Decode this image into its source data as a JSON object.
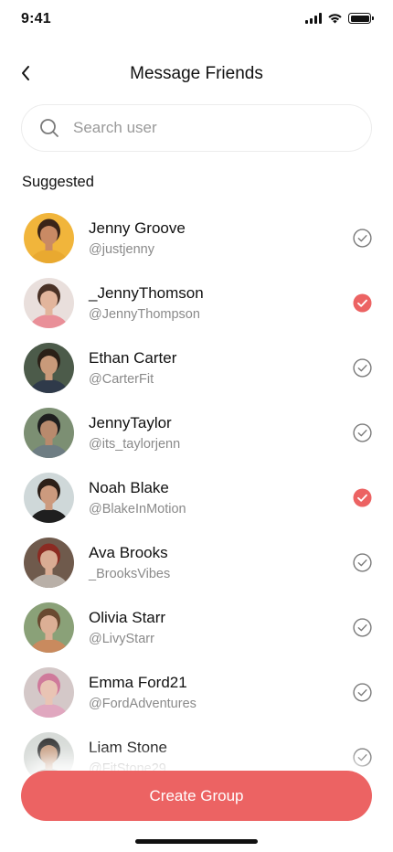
{
  "status_bar": {
    "time": "9:41"
  },
  "header": {
    "title": "Message Friends"
  },
  "search": {
    "placeholder": "Search user",
    "value": ""
  },
  "section": {
    "label": "Suggested"
  },
  "colors": {
    "accent": "#ec6363",
    "check_idle": "#7a7a7a",
    "muted_text": "#8a8a8a"
  },
  "users": [
    {
      "name": "Jenny Groove",
      "handle": "@justjenny",
      "selected": false,
      "avatar": {
        "bg": "#f1b53b",
        "skin": "#c98a64",
        "hair": "#3a2418",
        "shirt": "#e9a930"
      }
    },
    {
      "name": "_JennyThomson",
      "handle": "@JennyThompson",
      "selected": true,
      "avatar": {
        "bg": "#e9dfdc",
        "skin": "#e2b59c",
        "hair": "#4a3226",
        "shirt": "#e98f98"
      }
    },
    {
      "name": "Ethan Carter",
      "handle": "@CarterFit",
      "selected": false,
      "avatar": {
        "bg": "#4c5b4a",
        "skin": "#c99a7a",
        "hair": "#2b2017",
        "shirt": "#2f3a4a"
      }
    },
    {
      "name": "JennyTaylor",
      "handle": "@its_taylorjenn",
      "selected": false,
      "avatar": {
        "bg": "#7c8f73",
        "skin": "#b88a6d",
        "hair": "#1f1f1f",
        "shirt": "#6e7d83"
      }
    },
    {
      "name": "Noah Blake",
      "handle": "@BlakeInMotion",
      "selected": true,
      "avatar": {
        "bg": "#cfd8d9",
        "skin": "#cc9a7e",
        "hair": "#2c1f18",
        "shirt": "#1f1f1f"
      }
    },
    {
      "name": "Ava Brooks",
      "handle": "_BrooksVibes",
      "selected": false,
      "avatar": {
        "bg": "#6f5a4c",
        "skin": "#d9ac94",
        "hair": "#8b2b22",
        "shirt": "#b9b0a8"
      }
    },
    {
      "name": "Olivia Starr",
      "handle": "@LivyStarr",
      "selected": false,
      "avatar": {
        "bg": "#8aa178",
        "skin": "#dcaf95",
        "hair": "#6a4a30",
        "shirt": "#c98a5e"
      }
    },
    {
      "name": "Emma Ford21",
      "handle": "@FordAdventures",
      "selected": false,
      "avatar": {
        "bg": "#d4c8c8",
        "skin": "#e9c4b4",
        "hair": "#cf7a9b",
        "shirt": "#e0a7bf"
      }
    },
    {
      "name": "Liam Stone",
      "handle": "@FitStone29",
      "selected": false,
      "avatar": {
        "bg": "#d7dbd8",
        "skin": "#c69c80",
        "hair": "#3b3b3b",
        "shirt": "#5d6a5e"
      }
    }
  ],
  "footer": {
    "create_button_label": "Create Group"
  }
}
